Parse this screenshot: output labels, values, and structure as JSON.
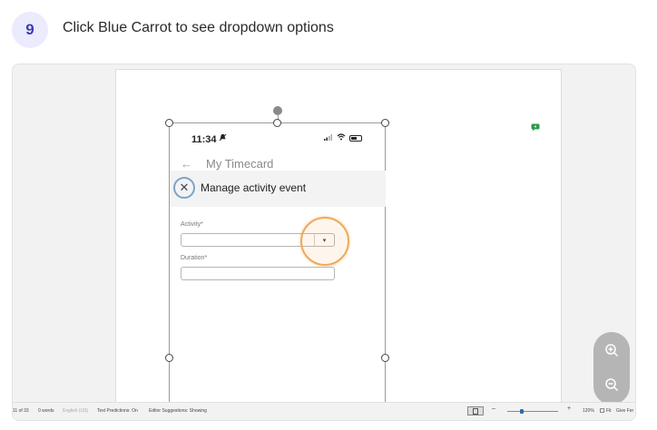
{
  "step": {
    "number": "9",
    "title": "Click Blue Carrot to see dropdown options"
  },
  "phone": {
    "time": "11:34",
    "nav_title": "My Timecard",
    "back_icon": "←",
    "dialog_title": "Manage activity event",
    "close_symbol": "✕",
    "activity_label": "Activity*",
    "duration_label": "Duration*",
    "caret_symbol": "▾"
  },
  "status_bar": {
    "page_info": "11 of 33",
    "words": "0 words",
    "language": "English (US)",
    "text_predictions": "Text Predictions: On",
    "editor_suggestions": "Editor Suggestions: Showing",
    "zoom_minus": "–",
    "zoom_plus": "+",
    "zoom_level": "120%",
    "fit": "Fit",
    "feedback": "Give Fer"
  },
  "colors": {
    "badge_bg": "#ebebfd",
    "badge_text": "#3b3bb0",
    "highlight_ring": "#f1a85a",
    "close_ring": "#7aa5c9"
  }
}
